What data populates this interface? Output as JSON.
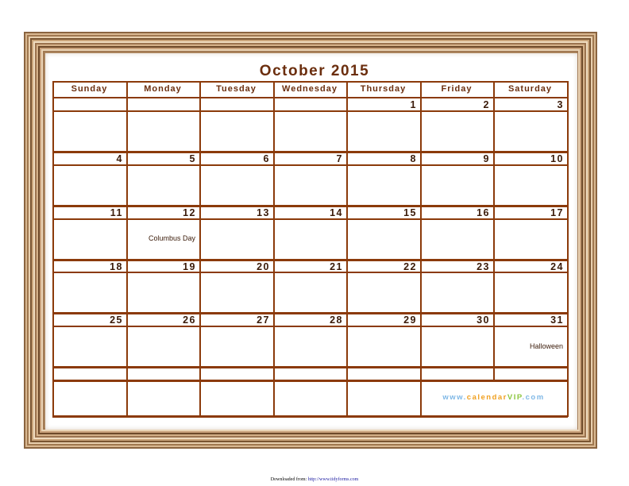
{
  "title": "October 2015",
  "days": [
    "Sunday",
    "Monday",
    "Tuesday",
    "Wednesday",
    "Thursday",
    "Friday",
    "Saturday"
  ],
  "weeks": [
    [
      "",
      "",
      "",
      "",
      "1",
      "2",
      "3"
    ],
    [
      "4",
      "5",
      "6",
      "7",
      "8",
      "9",
      "10"
    ],
    [
      "11",
      "12",
      "13",
      "14",
      "15",
      "16",
      "17"
    ],
    [
      "18",
      "19",
      "20",
      "21",
      "22",
      "23",
      "24"
    ],
    [
      "25",
      "26",
      "27",
      "28",
      "29",
      "30",
      "31"
    ]
  ],
  "holidays": {
    "columbus": "Columbus Day",
    "halloween": "Halloween"
  },
  "logo": {
    "prefix": "www.",
    "brand": "calendar",
    "vip": "VIP",
    "suffix": ".com"
  },
  "footer": {
    "label": "Downloaded from: ",
    "link": "http://www.tidyforms.com"
  },
  "colors": {
    "grid": "#8b3a0a",
    "title": "#6b2e0e",
    "frame": "#b08a62"
  }
}
